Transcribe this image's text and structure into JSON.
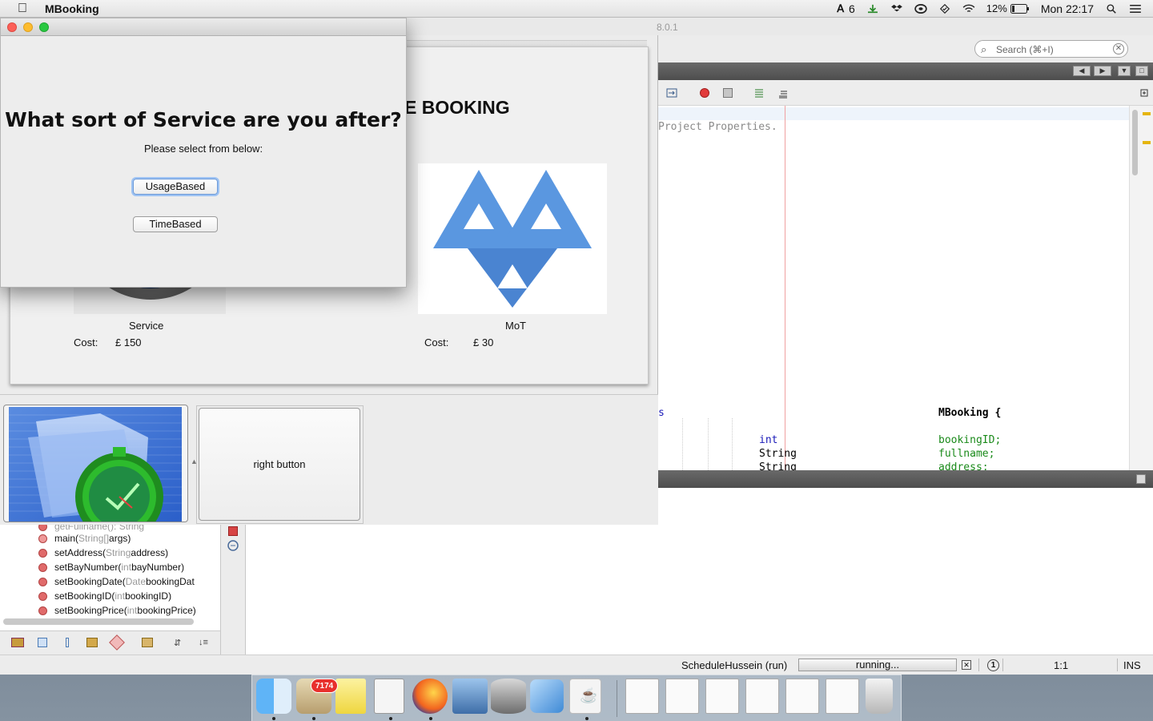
{
  "menubar": {
    "app_name": "MBooking",
    "adobe_count": "6",
    "battery": "12%",
    "clock": "Mon 22:17"
  },
  "ide": {
    "version_fragment": "8.0.1",
    "search_placeholder": "Search (⌘+I)",
    "editor_lines": [
      {
        "text": "Project Properties.",
        "color": "#8a8a8a"
      },
      {
        "text": "s",
        "color": "#1a1ab8"
      },
      {
        "text": "MBooking {",
        "color": "#000000"
      },
      {
        "text": "int",
        "color": "#1a1ab8"
      },
      {
        "text": "bookingID;",
        "color": "#1a8a1a"
      },
      {
        "text": "String",
        "color": "#000000"
      },
      {
        "text": "fullname;",
        "color": "#1a8a1a"
      },
      {
        "text": "String",
        "color": "#000000"
      },
      {
        "text": "address;",
        "color": "#1a8a1a"
      }
    ],
    "navigator_items": [
      {
        "name": "getFullname()",
        "type": " : String"
      },
      {
        "name": "main(",
        "type": "String[]",
        "rest": " args)"
      },
      {
        "name": "setAddress(",
        "type": "String",
        "rest": " address)"
      },
      {
        "name": "setBayNumber(",
        "type": "int",
        "rest": " bayNumber)"
      },
      {
        "name": "setBookingDate(",
        "type": "Date",
        "rest": " bookingDat"
      },
      {
        "name": "setBookingID(",
        "type": "int",
        "rest": " bookingID)"
      },
      {
        "name": "setBookingPrice(",
        "type": "int",
        "rest": " bookingPrice)"
      }
    ],
    "status": {
      "process": "ScheduleHussein (run)",
      "progress": "running...",
      "position": "1:1",
      "mode": "INS"
    }
  },
  "app": {
    "booking_title_fragment": "E BOOKING",
    "service": {
      "label": "Service",
      "cost_label": "Cost:",
      "cost_value": "£ 150"
    },
    "mot": {
      "label": "MoT",
      "cost_label": "Cost:",
      "cost_value": "£ 30"
    },
    "right_button": "right button"
  },
  "dialog": {
    "heading": "What sort of Service are you after?",
    "subtitle": "Please select from below:",
    "usage_button": "UsageBased",
    "time_button": "TimeBased"
  },
  "dock": {
    "mail_badge": "7174"
  },
  "colors": {
    "mot_blue": "#5a97e0",
    "traffic_red": "#fc5f57",
    "traffic_yellow": "#fdbc2e",
    "traffic_green": "#29c840"
  }
}
